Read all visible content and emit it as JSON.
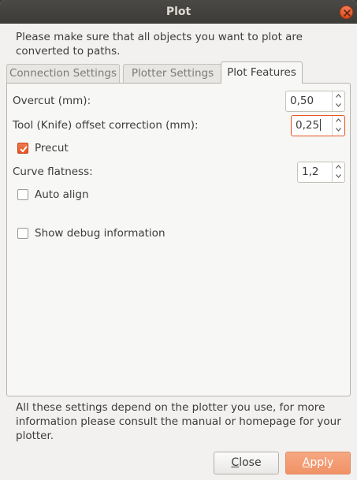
{
  "window": {
    "title": "Plot"
  },
  "intro_text": "Please make sure that all objects you want to plot are converted to paths.",
  "tabs": [
    {
      "label": "Connection Settings",
      "active": false
    },
    {
      "label": "Plotter Settings",
      "active": false
    },
    {
      "label": "Plot Features",
      "active": true
    }
  ],
  "plot_features": {
    "overcut": {
      "label": "Overcut (mm):",
      "value": "0,50"
    },
    "tool_offset": {
      "label": "Tool (Knife) offset correction (mm):",
      "value": "0,25"
    },
    "precut": {
      "label": "Precut",
      "checked": true
    },
    "curve_flatness": {
      "label": "Curve flatness:",
      "value": "1,2"
    },
    "auto_align": {
      "label": "Auto align",
      "checked": false
    },
    "show_debug": {
      "label": "Show debug information",
      "checked": false
    }
  },
  "footer_note": "All these settings depend on the plotter you use, for more information please consult the manual or homepage for your plotter.",
  "buttons": {
    "close_first": "C",
    "close_rest": "lose",
    "apply_first": "A",
    "apply_rest": "pply"
  },
  "colors": {
    "accent": "#e95420",
    "titlebar": "#3c3b37",
    "window_bg": "#f2f1f0"
  },
  "icons": [
    "close-icon",
    "chevron-up-icon",
    "chevron-down-icon",
    "checkmark-icon"
  ]
}
